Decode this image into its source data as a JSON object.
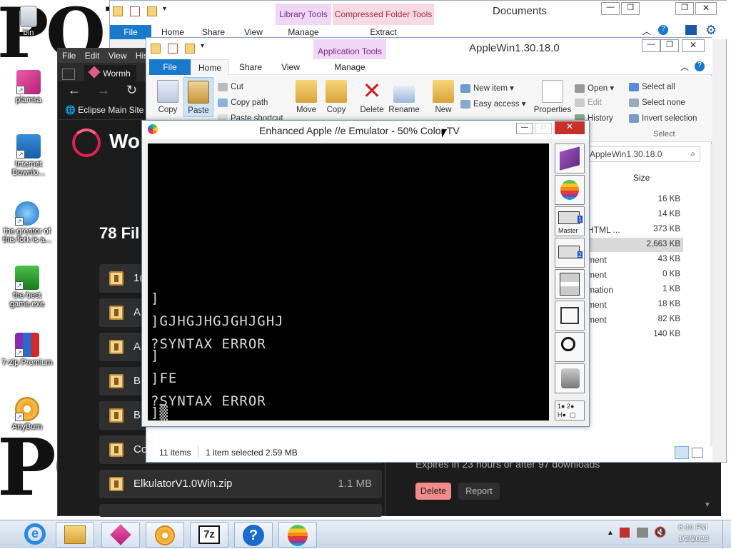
{
  "desktop": {
    "graffiti_top": "PORN",
    "graffiti_bottom": "PORN",
    "icons": [
      {
        "label": "bin"
      },
      {
        "label": "plamsa"
      },
      {
        "label": "Internet Downlo..."
      },
      {
        "label": "the greator of this fork is a..."
      },
      {
        "label": "the best game.exe"
      },
      {
        "label": "7-zip Premium"
      },
      {
        "label": "AnyBurn"
      }
    ]
  },
  "dark_window": {
    "menu": [
      "File",
      "Edit",
      "View",
      "His"
    ],
    "tab_label": "Wormh",
    "bookmark": "Eclipse Main Site",
    "brand": "Wor",
    "files_heading": "78 Fil",
    "files": [
      {
        "name": "1(",
        "size": ""
      },
      {
        "name": "A",
        "size": ""
      },
      {
        "name": "A",
        "size": ""
      },
      {
        "name": "B",
        "size": ""
      },
      {
        "name": "Ba",
        "size": ""
      },
      {
        "name": "Co",
        "size": ""
      },
      {
        "name": "ElkulatorV1.0Win.zip",
        "size": "1.1 MB"
      }
    ],
    "expires": "Expires in 23 hours or after 97 downloads",
    "delete_label": "Delete",
    "report_label": "Report"
  },
  "explorer_back": {
    "title": "Documents",
    "context_tabs": {
      "library": "Library Tools",
      "compressed": "Compressed Folder Tools"
    },
    "tabs": [
      "File",
      "Home",
      "Share",
      "View"
    ],
    "sub": {
      "manage": "Manage",
      "extract": "Extract"
    }
  },
  "explorer": {
    "title": "AppleWin1.30.18.0",
    "context_tab": "Application Tools",
    "tabs": [
      "File",
      "Home",
      "Share",
      "View"
    ],
    "manage": "Manage",
    "clipboard": {
      "copy": "Copy",
      "paste": "Paste",
      "cut": "Cut",
      "copy_path": "Copy path",
      "paste_shortcut": "Paste shortcut"
    },
    "organize": {
      "move": "Move",
      "copy": "Copy",
      "delete": "Delete",
      "rename": "Rename"
    },
    "new": {
      "new_folder": "New",
      "new_item": "New item ▾",
      "easy_access": "Easy access ▾"
    },
    "open": {
      "properties": "Properties",
      "open": "Open ▾",
      "edit": "Edit",
      "history": "History"
    },
    "select": {
      "all": "Select all",
      "none": "Select none",
      "invert": "Invert selection",
      "group": "Select"
    },
    "search_placeholder": "AppleWin1.30.18.0",
    "size_header": "Size",
    "rows": [
      {
        "type": "",
        "size": "16 KB"
      },
      {
        "type": "",
        "size": "14 KB"
      },
      {
        "type": "HTML ...",
        "size": "373 KB"
      },
      {
        "type": "",
        "size": "2,663 KB"
      },
      {
        "type": "ment",
        "size": "43 KB"
      },
      {
        "type": "ment",
        "size": "0 KB"
      },
      {
        "type": "mation",
        "size": "1 KB"
      },
      {
        "type": "ment",
        "size": "18 KB"
      },
      {
        "type": "ment",
        "size": "82 KB"
      },
      {
        "type": "",
        "size": "140 KB"
      }
    ],
    "status": {
      "items": "11 items",
      "selected": "1 item selected  2.59 MB"
    }
  },
  "emulator": {
    "title": "Enhanced Apple //e Emulator -  50% Color TV",
    "lines": [
      "]",
      "]GJHGJHGJGHJGHJ",
      "?SYNTAX ERROR",
      "]",
      "]FE",
      "?SYNTAX ERROR",
      "]▒"
    ],
    "side_labels": {
      "master": "Master",
      "d1": "1",
      "d2": "2"
    },
    "leds": "1● 2●\nH●  ▢"
  },
  "taskbar": {
    "clock_time": "6:44 PM",
    "clock_date": "1/2/2023",
    "apps": [
      "Internet Explorer",
      "File Explorer",
      "Plasma",
      "AnyBurn",
      "7z",
      "Help",
      "AppleWin"
    ],
    "sevenz_label": "7z",
    "help_label": "?"
  }
}
